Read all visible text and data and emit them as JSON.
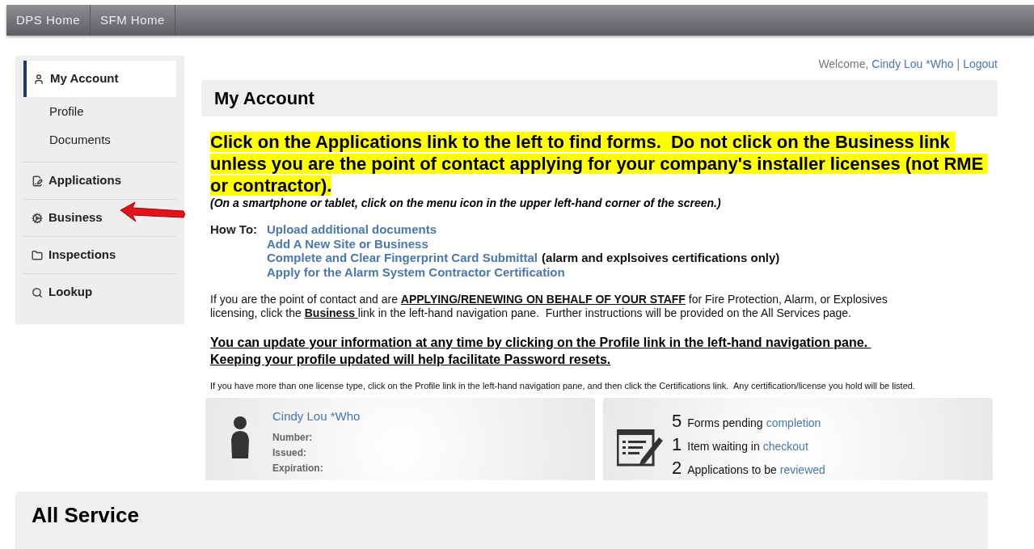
{
  "nav_bar": {
    "items": [
      {
        "label": "DPS Home"
      },
      {
        "label": "SFM Home"
      }
    ]
  },
  "sidebar": {
    "items": [
      {
        "label": "My Account",
        "selected": true,
        "children": [
          {
            "label": "Profile"
          },
          {
            "label": "Documents"
          }
        ]
      },
      {
        "label": "Applications",
        "selected": false
      },
      {
        "label": "Business",
        "selected": false,
        "annotated": true
      },
      {
        "label": "Inspections",
        "selected": false
      },
      {
        "label": "Lookup",
        "selected": false
      }
    ]
  },
  "welcome": {
    "greeting": "Welcome,",
    "user": "Cindy Lou *Who",
    "separator": "|",
    "logout": "Logout"
  },
  "page_title": "My Account",
  "notice": "Click on the Applications link to the left to find forms.  Do not click on the Business link unless you are the point of contact applying for your company's installer licenses (not RME or contractor).",
  "mobile_hint": "(On a smartphone or tablet, click on the menu icon in the upper left-hand corner of the screen.)",
  "how_to": {
    "label": "How To:",
    "links": [
      {
        "text": "Upload additional documents"
      },
      {
        "text": "Add A New Site or Business"
      },
      {
        "text": "Complete and Clear Fingerprint Card Submittal",
        "note": "(alarm and explsoives certifications only)"
      },
      {
        "text": "Apply for the Alarm System Contractor Certification"
      }
    ]
  },
  "staff_paragraph": [
    {
      "kind": "plain",
      "text": "If you are the point of contact and are "
    },
    {
      "kind": "emphasis",
      "text": "APPLYING/RENEWING ON BEHALF OF YOUR STAFF"
    },
    {
      "kind": "plain",
      "text": " for Fire Protection, Alarm, or Explosives licensing, click the "
    },
    {
      "kind": "link",
      "text": "Business "
    },
    {
      "kind": "plain",
      "text": "link in the left-hand navigation pane.  Further instructions will be provided on the All Services page."
    }
  ],
  "profile_notice": [
    "You can update your information at any time by clicking on the Profile link in the left-hand navigation pane. ",
    "Keeping your profile updated will help facilitate Password resets."
  ],
  "license_note": "If you have more than one license type, click on the Profile link in the left-hand navigation pane, and then click the Certifications link.  Any certification/license you hold will be listed.",
  "profile_card": {
    "name": "Cindy Lou *Who",
    "fields": [
      "Number:",
      "Issued:",
      "Expiration:"
    ]
  },
  "status_card": {
    "items": [
      {
        "count": "5",
        "text": "Forms pending",
        "link": "completion"
      },
      {
        "count": "1",
        "text": "Item waiting in",
        "link": "checkout"
      },
      {
        "count": "2",
        "text": "Applications to be",
        "link": "reviewed"
      }
    ]
  },
  "all_services": {
    "title": "All Service"
  }
}
